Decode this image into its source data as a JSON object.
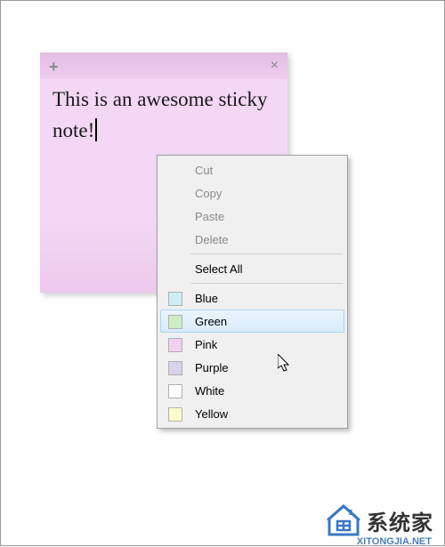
{
  "sticky": {
    "text": "This is an awesome sticky note!"
  },
  "menu": {
    "edit": {
      "cut": "Cut",
      "copy": "Copy",
      "paste": "Paste",
      "delete": "Delete"
    },
    "selectAll": "Select All",
    "colors": [
      {
        "label": "Blue",
        "swatch": "#cfeef0"
      },
      {
        "label": "Green",
        "swatch": "#ceedc5"
      },
      {
        "label": "Pink",
        "swatch": "#f3d0f2"
      },
      {
        "label": "Purple",
        "swatch": "#d9d2ea"
      },
      {
        "label": "White",
        "swatch": "#ffffff"
      },
      {
        "label": "Yellow",
        "swatch": "#fdfccb"
      }
    ],
    "hoveredIndex": 1
  },
  "watermark": {
    "brand": "系统家",
    "url": "XITONGJIA.NET"
  }
}
